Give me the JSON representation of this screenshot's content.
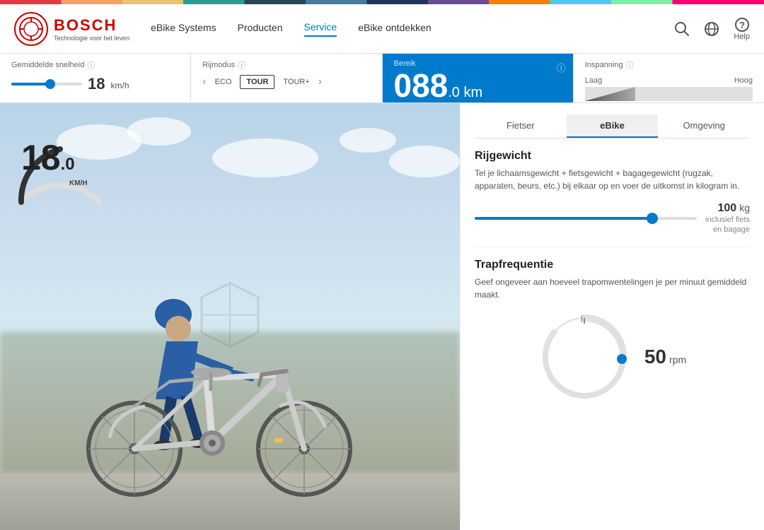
{
  "rainbow_bar": true,
  "navbar": {
    "logo_circle_text": "⊕",
    "brand_name": "BOSCH",
    "brand_tagline": "Technologie voor het leven",
    "nav_items": [
      {
        "label": "eBike Systems",
        "active": false
      },
      {
        "label": "Producten",
        "active": false
      },
      {
        "label": "Service",
        "active": true
      },
      {
        "label": "eBike ontdekken",
        "active": false
      }
    ],
    "search_label": "🔍",
    "globe_label": "🌐",
    "help_label": "Help"
  },
  "metrics": {
    "speed": {
      "label": "Gemiddelde snelheid",
      "value": "18",
      "unit": "km/h"
    },
    "ride_mode": {
      "label": "Rijmodus",
      "options": [
        "ECO",
        "TOUR",
        "TOUR+"
      ],
      "active": "TOUR"
    },
    "bereik": {
      "label": "Bereik",
      "value": "088",
      "decimal": ".0",
      "unit": "km"
    },
    "inspanning": {
      "label": "Inspanning",
      "low_label": "Laag",
      "high_label": "Hoog"
    }
  },
  "speedometer": {
    "value": "18",
    "decimal": ".0",
    "unit": "KM/H"
  },
  "right_panel": {
    "tabs": [
      {
        "label": "Fietser",
        "active": false
      },
      {
        "label": "eBike",
        "active": true
      },
      {
        "label": "Omgeving",
        "active": false
      }
    ],
    "rijgewicht": {
      "title": "Rijgewicht",
      "description": "Tel je lichaamsgewicht + fietsgewicht + bagagegewicht (rugzak, apparaten, beurs, etc.) bij elkaar op en voer de uitkomst in kilogram in.",
      "value": "100",
      "unit": "kg",
      "sublabel": "inclusief fiets\nen bagage",
      "slider_pct": 80
    },
    "trapfrequentie": {
      "title": "Trapfrequentie",
      "description": "Geef ongeveer aan hoeveel trapomwentelingen je per minuut gemiddeld maakt.",
      "value": "50",
      "unit": "rpm"
    }
  }
}
